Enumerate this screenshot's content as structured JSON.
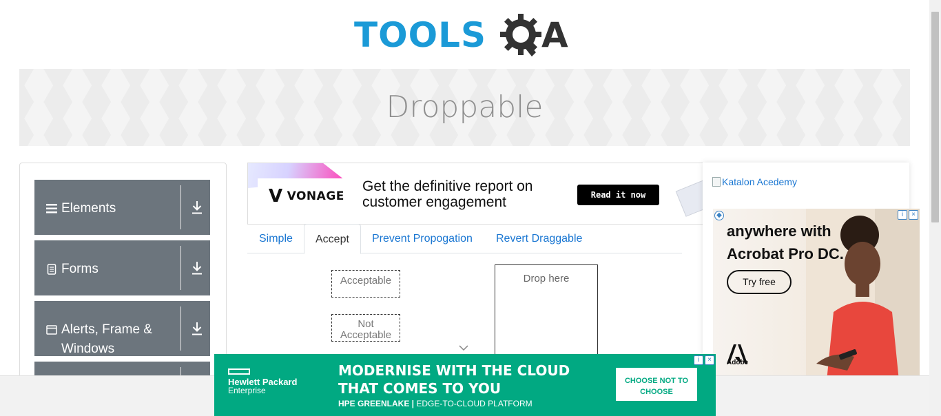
{
  "brand": {
    "logo_text": "TOOLS",
    "logo_suffix": "A"
  },
  "banner": {
    "title": "Droppable"
  },
  "sidebar": {
    "groups": [
      {
        "label": "Elements",
        "icon": "hamburger-icon"
      },
      {
        "label": "Forms",
        "icon": "document-icon"
      },
      {
        "label": "Alerts, Frame & Windows",
        "icon": "window-icon"
      }
    ]
  },
  "top_ad": {
    "brand": "VONAGE",
    "headline": "Get the definitive report on customer engagement",
    "cta": "Read it now"
  },
  "tabs": [
    {
      "label": "Simple",
      "active": false
    },
    {
      "label": "Accept",
      "active": true
    },
    {
      "label": "Prevent Propogation",
      "active": false
    },
    {
      "label": "Revert Draggable",
      "active": false
    }
  ],
  "accept_panel": {
    "acceptable_label": "Acceptable",
    "not_acceptable_label": "Not Acceptable",
    "drop_label": "Drop here"
  },
  "right_col": {
    "katalon_alt": "Katalon Acedemy"
  },
  "adobe_ad": {
    "headline": "anywhere with Acrobat Pro DC.",
    "cta": "Try free",
    "brand": "Adobe"
  },
  "hpe_ad": {
    "company_line1": "Hewlett Packard",
    "company_line2": "Enterprise",
    "headline": "MODERNISE WITH THE CLOUD THAT COMES TO YOU",
    "tag_bold": "HPE GREENLAKE |",
    "tag_rest": "EDGE-TO-CLOUD PLATFORM",
    "cta": "CHOOSE NOT TO CHOOSE"
  },
  "colors": {
    "brand_blue": "#1b9ad7",
    "sidebar_gray": "#6c757d",
    "link_blue": "#1976d2",
    "hpe_green": "#01a982"
  }
}
